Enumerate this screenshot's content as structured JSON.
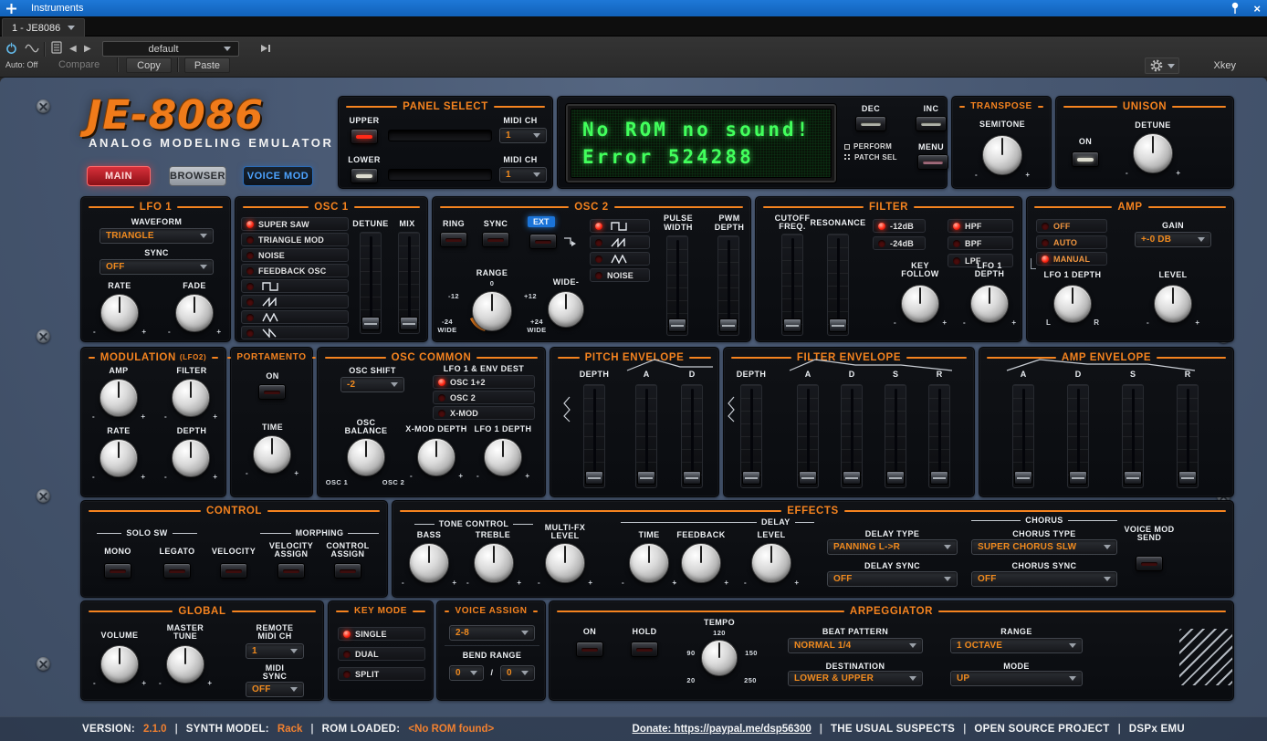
{
  "ui": {
    "minus": "-",
    "plus": "+",
    "slash": "/",
    "sep": "|"
  },
  "icons": {
    "prev": "◀",
    "next": "▶",
    "close": "×"
  },
  "titlebar": {
    "title": "Instruments"
  },
  "tabbar": {
    "tab": "1 - JE8086"
  },
  "toolbar": {
    "preset": "default",
    "auto": "Auto: Off",
    "compare": "Compare",
    "copy": "Copy",
    "paste": "Paste",
    "xkey": "Xkey"
  },
  "brand": {
    "logo": "JE-8086",
    "subtitle": "ANALOG MODELING EMULATOR",
    "main": "MAIN",
    "browser": "BROWSER",
    "voice_mod": "VOICE MOD"
  },
  "panel_select": {
    "title": "PANEL SELECT",
    "upper": "UPPER",
    "lower": "LOWER",
    "midi_ch": "MIDI CH",
    "upper_ch": "1",
    "lower_ch": "1"
  },
  "display": {
    "line1": "No ROM no sound!",
    "line2": "Error 524288",
    "dec": "DEC",
    "inc": "INC",
    "perform": "PERFORM",
    "patch_sel": "PATCH SEL",
    "menu": "MENU"
  },
  "transpose": {
    "title": "TRANSPOSE",
    "semitone": "SEMITONE"
  },
  "unison": {
    "title": "UNISON",
    "on": "ON",
    "detune": "DETUNE"
  },
  "lfo1": {
    "title": "LFO 1",
    "waveform": "WAVEFORM",
    "waveform_value": "TRIANGLE",
    "sync": "SYNC",
    "sync_value": "OFF",
    "rate": "RATE",
    "fade": "FADE"
  },
  "osc1": {
    "title": "OSC 1",
    "opts": [
      "SUPER SAW",
      "TRIANGLE MOD",
      "NOISE",
      "FEEDBACK OSC"
    ],
    "detune": "DETUNE",
    "mix": "MIX"
  },
  "osc2": {
    "title": "OSC 2",
    "ring": "RING",
    "sync": "SYNC",
    "ext": "EXT",
    "range": "RANGE",
    "zero": "0",
    "m12": "-12",
    "p12": "+12",
    "m24": "-24",
    "p24": "+24",
    "wide": "WIDE",
    "wide_minus": "WIDE-",
    "noise": "NOISE",
    "pw1": "PULSE",
    "pw2": "WIDTH",
    "pwm1": "PWM",
    "pwm2": "DEPTH"
  },
  "filter": {
    "title": "FILTER",
    "cutoff1": "CUTOFF",
    "cutoff2": "FREQ.",
    "resonance": "RESONANCE",
    "db12": "-12dB",
    "db24": "-24dB",
    "hpf": "HPF",
    "bpf": "BPF",
    "lpf": "LPF",
    "key1": "KEY",
    "key2": "FOLLOW",
    "lfo1": "LFO 1",
    "depth": "DEPTH"
  },
  "amp": {
    "title": "AMP",
    "off": "OFF",
    "auto": "AUTO",
    "manual": "MANUAL",
    "gain": "GAIN",
    "gain_value": "+-0 DB",
    "lfo_depth": "LFO 1 DEPTH",
    "level": "LEVEL",
    "l": "L",
    "r": "R"
  },
  "modulation": {
    "title": "MODULATION",
    "sub": "(LFO2)",
    "amp": "AMP",
    "filter": "FILTER",
    "rate": "RATE",
    "depth": "DEPTH"
  },
  "portamento": {
    "title": "PORTAMENTO",
    "on": "ON",
    "time": "TIME"
  },
  "osc_common": {
    "title": "OSC COMMON",
    "shift": "OSC SHIFT",
    "shift_value": "-2",
    "dest": "LFO 1 & ENV DEST",
    "dests": [
      "OSC 1+2",
      "OSC 2",
      "X-MOD"
    ],
    "bal1": "OSC",
    "bal2": "BALANCE",
    "xmod": "X-MOD DEPTH",
    "lfo_depth": "LFO 1 DEPTH",
    "osc1": "OSC 1",
    "osc2": "OSC 2"
  },
  "pitch_env": {
    "title": "PITCH ENVELOPE",
    "depth": "DEPTH",
    "a": "A",
    "d": "D"
  },
  "filter_env": {
    "title": "FILTER ENVELOPE",
    "depth": "DEPTH",
    "a": "A",
    "d": "D",
    "s": "S",
    "r": "R"
  },
  "amp_env": {
    "title": "AMP ENVELOPE",
    "a": "A",
    "d": "D",
    "s": "S",
    "r": "R"
  },
  "control": {
    "title": "CONTROL",
    "solo": "SOLO SW",
    "mono": "MONO",
    "legato": "LEGATO",
    "velocity": "VELOCITY",
    "morphing": "MORPHING",
    "va1": "VELOCITY",
    "va2": "ASSIGN",
    "ca1": "CONTROL",
    "ca2": "ASSIGN"
  },
  "effects": {
    "title": "EFFECTS",
    "tone": "TONE CONTROL",
    "bass": "BASS",
    "treble": "TREBLE",
    "mfx1": "MULTI-FX",
    "mfx2": "LEVEL",
    "delay": "DELAY",
    "time": "TIME",
    "feedback": "FEEDBACK",
    "level": "LEVEL",
    "delay_type": "DELAY TYPE",
    "delay_type_value": "PANNING L->R",
    "delay_sync": "DELAY SYNC",
    "delay_sync_value": "OFF",
    "chorus": "CHORUS",
    "chorus_type": "CHORUS TYPE",
    "chorus_type_value": "SUPER CHORUS SLW",
    "chorus_sync": "CHORUS SYNC",
    "chorus_sync_value": "OFF",
    "vm1": "VOICE MOD",
    "vm2": "SEND"
  },
  "global": {
    "title": "GLOBAL",
    "volume": "VOLUME",
    "mt1": "MASTER",
    "mt2": "TUNE",
    "rm1": "REMOTE",
    "rm2": "MIDI CH",
    "remote_value": "1",
    "ms1": "MIDI",
    "ms2": "SYNC",
    "midi_sync_value": "OFF"
  },
  "key_mode": {
    "title": "KEY MODE",
    "single": "SINGLE",
    "dual": "DUAL",
    "split": "SPLIT"
  },
  "voice_assign": {
    "title": "VOICE ASSIGN",
    "value": "2-8",
    "bend": "BEND RANGE",
    "bend1": "0",
    "bend2": "0"
  },
  "arp": {
    "title": "ARPEGGIATOR",
    "on": "ON",
    "hold": "HOLD",
    "tempo": "TEMPO",
    "t120": "120",
    "t90": "90",
    "t150": "150",
    "t20": "20",
    "t250": "250",
    "beat": "BEAT PATTERN",
    "beat_value": "NORMAL 1/4",
    "range": "RANGE",
    "range_value": "1 OCTAVE",
    "dest": "DESTINATION",
    "dest_value": "LOWER & UPPER",
    "mode": "MODE",
    "mode_value": "UP"
  },
  "footer": {
    "version_label": "VERSION:",
    "version": "2.1.0",
    "model_label": "SYNTH MODEL:",
    "model": "Rack",
    "rom_label": "ROM LOADED:",
    "rom": "<No ROM found>",
    "donate": "Donate: https://paypal.me/dsp56300",
    "c1": "THE USUAL SUSPECTS",
    "c2": "OPEN SOURCE PROJECT",
    "c3": "DSPx EMU"
  },
  "colors": {
    "accent_orange": "#f5831f",
    "lcd_green": "#42ff5c",
    "led_red": "#ff2a18",
    "panel_blue": "#45556c"
  }
}
